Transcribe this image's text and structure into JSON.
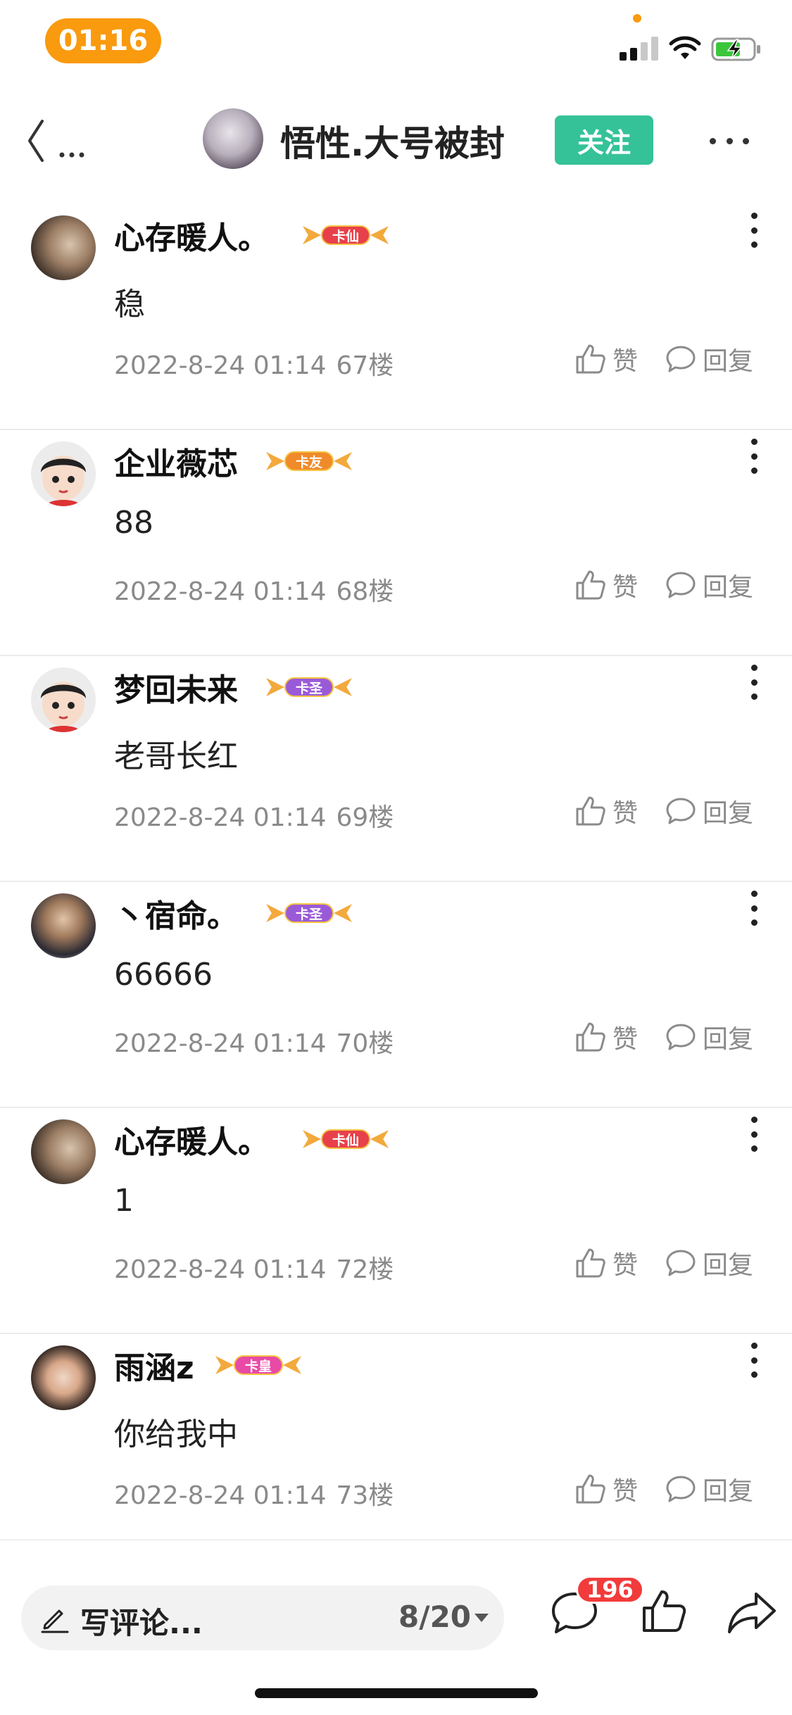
{
  "status_bar": {
    "time": "01:16",
    "signal_icon": "cellular-signal-icon",
    "wifi_icon": "wifi-icon",
    "battery_icon": "battery-charging-icon"
  },
  "nav": {
    "back_icon": "chevron-left-icon",
    "title": "悟性.大号被封",
    "follow_label": "关注",
    "more_icon": "more-horizontal-icon"
  },
  "comments": [
    {
      "username": "心存暖人。",
      "badge": "卡仙",
      "badge_color": "#e8404a",
      "text": "稳",
      "date": "2022-8-24 01:14",
      "floor": "67楼",
      "like_label": "赞",
      "reply_label": "回复"
    },
    {
      "username": "企业薇芯",
      "badge": "卡友",
      "badge_color": "#f08a2a",
      "text": "88",
      "date": "2022-8-24 01:14",
      "floor": "68楼",
      "like_label": "赞",
      "reply_label": "回复"
    },
    {
      "username": "梦回未来",
      "badge": "卡圣",
      "badge_color": "#9a5ad8",
      "text": "老哥长红",
      "date": "2022-8-24 01:14",
      "floor": "69楼",
      "like_label": "赞",
      "reply_label": "回复"
    },
    {
      "username": "丶宿命。",
      "badge": "卡圣",
      "badge_color": "#9a5ad8",
      "text": "66666",
      "date": "2022-8-24 01:14",
      "floor": "70楼",
      "like_label": "赞",
      "reply_label": "回复"
    },
    {
      "username": "心存暖人。",
      "badge": "卡仙",
      "badge_color": "#e8404a",
      "text": "1",
      "date": "2022-8-24 01:14",
      "floor": "72楼",
      "like_label": "赞",
      "reply_label": "回复"
    },
    {
      "username": "雨涵z",
      "badge": "卡皇",
      "badge_color": "#e84aa6",
      "text": "你给我中",
      "date": "2022-8-24 01:14",
      "floor": "73楼",
      "like_label": "赞",
      "reply_label": "回复"
    }
  ],
  "bottom_bar": {
    "comment_placeholder": "写评论...",
    "page_indicator": "8/20",
    "comment_count": "196",
    "comment_icon": "comment-bubble-icon",
    "like_icon": "thumbs-up-icon",
    "share_icon": "share-arrow-icon"
  }
}
